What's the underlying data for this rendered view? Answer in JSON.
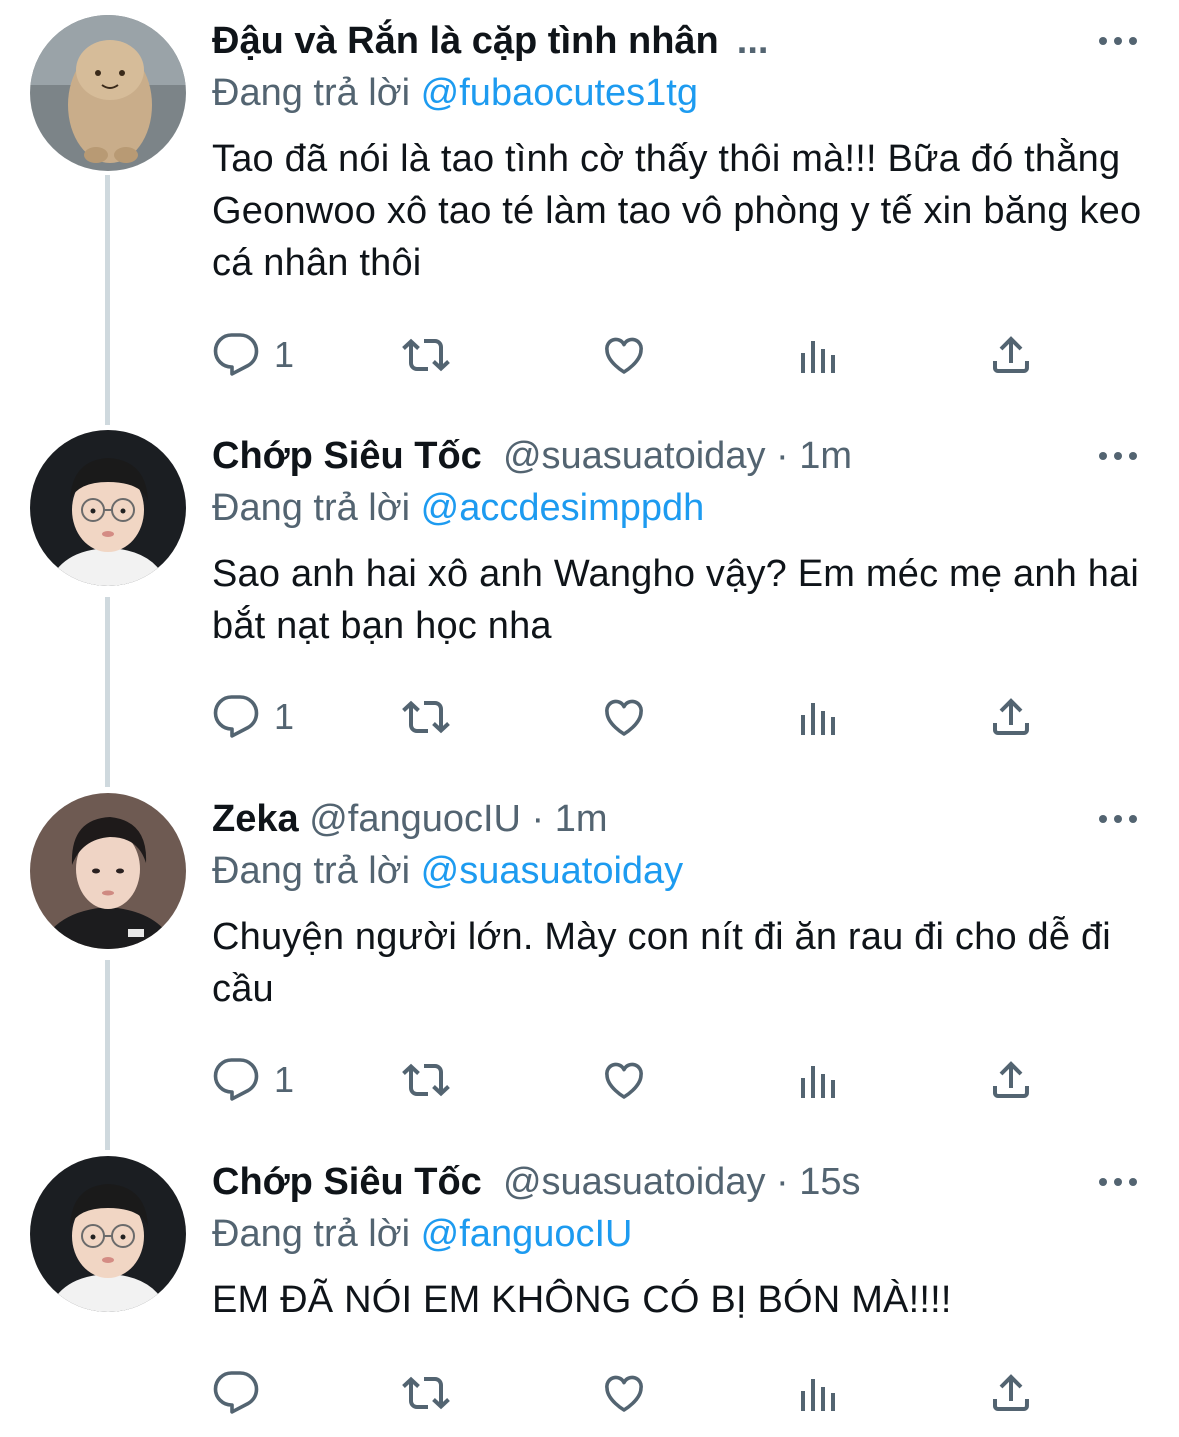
{
  "reply_prefix": "Đang trả lời",
  "tweets": [
    {
      "name": "Đậu và Rắn là cặp tình nhân",
      "name_suffix": "...",
      "handle": "",
      "dot": "",
      "time": "",
      "reply_to": "@fubaocutes1tg",
      "text": "Tao đã nói là tao tình cờ thấy thôi mà!!! Bữa đó thằng Geonwoo xô tao té làm tao vô phòng y tế xin băng keo cá nhân thôi",
      "reply_count": "1"
    },
    {
      "name": "Chớp Siêu Tốc",
      "name_suffix": "",
      "handle": "@suasuatoiday",
      "dot": " · ",
      "time": "1m",
      "reply_to": "@accdesimppdh",
      "text": "Sao anh hai xô anh Wangho vậy? Em méc mẹ anh hai bắt nạt bạn học nha",
      "reply_count": "1"
    },
    {
      "name": "Zeka",
      "name_suffix": "",
      "handle": "@fanguocIU",
      "dot": " · ",
      "time": "1m",
      "reply_to": "@suasuatoiday",
      "text": "Chuyện người lớn. Mày con nít đi ăn rau đi cho dễ đi cầu",
      "reply_count": "1"
    },
    {
      "name": "Chớp Siêu Tốc",
      "name_suffix": "",
      "handle": "@suasuatoiday",
      "dot": " · ",
      "time": "15s",
      "reply_to": "@fanguocIU",
      "text": "EM ĐÃ NÓI EM KHÔNG CÓ BỊ BÓN MÀ!!!!",
      "reply_count": ""
    }
  ],
  "colors": {
    "text": "#0f1419",
    "secondary": "#536471",
    "link": "#1d9bf0",
    "thread_line": "#cfd9de"
  }
}
